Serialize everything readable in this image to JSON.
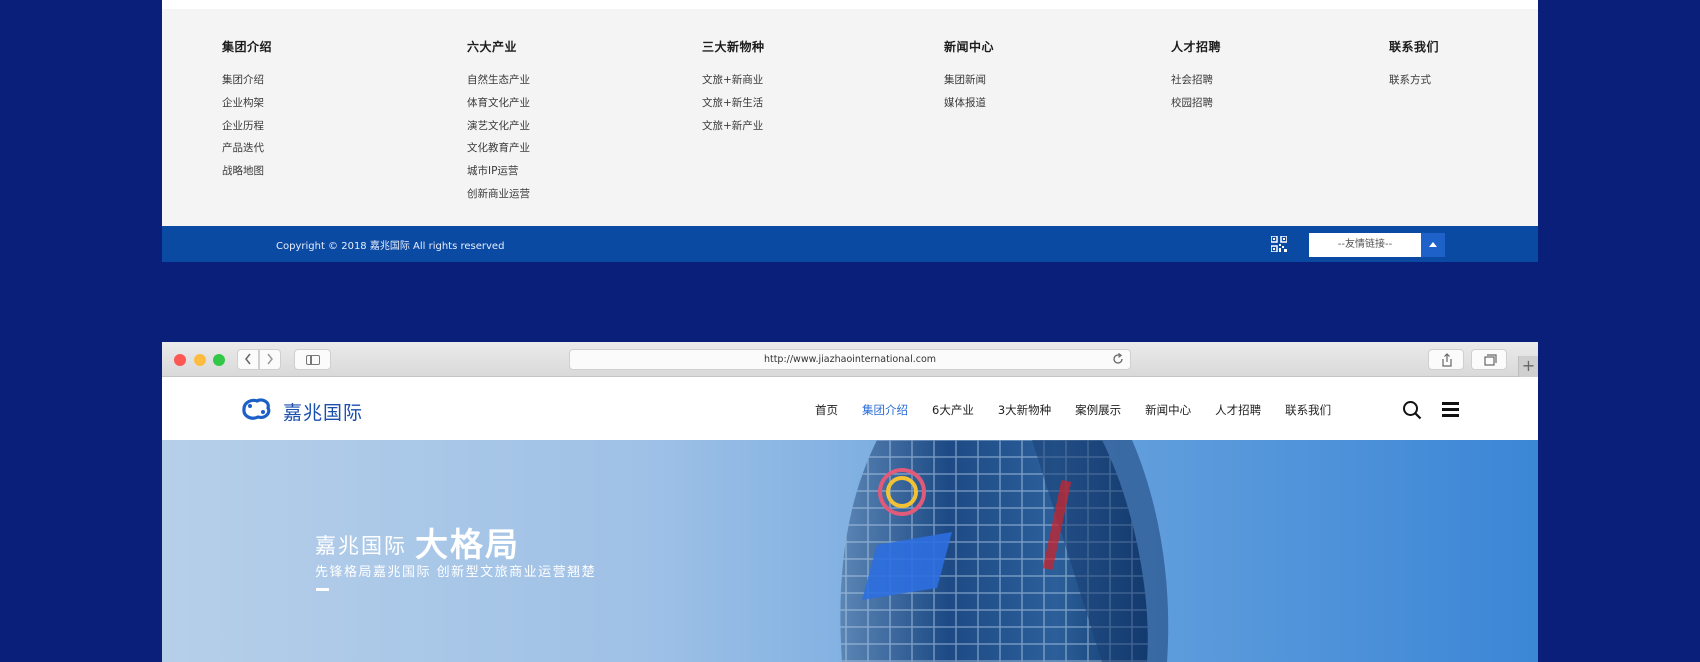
{
  "footer": {
    "columns": [
      {
        "title": "集团介绍",
        "items": [
          "集团介绍",
          "企业构架",
          "企业历程",
          "产品迭代",
          "战略地图"
        ]
      },
      {
        "title": "六大产业",
        "items": [
          "自然生态产业",
          "体育文化产业",
          "演艺文化产业",
          "文化教育产业",
          "城市IP运营",
          "创新商业运营"
        ]
      },
      {
        "title": "三大新物种",
        "items": [
          "文旅+新商业",
          "文旅+新生活",
          "文旅+新产业"
        ]
      },
      {
        "title": "新闻中心",
        "items": [
          "集团新闻",
          "媒体报道"
        ]
      },
      {
        "title": "人才招聘",
        "items": [
          "社会招聘",
          "校园招聘"
        ]
      },
      {
        "title": "联系我们",
        "items": [
          "联系方式"
        ]
      }
    ],
    "copyright": "Copyright © 2018  嘉兆国际  All rights reserved",
    "friend_links_placeholder": "--友情链接--",
    "qr_icon": "qr-code-icon"
  },
  "browser": {
    "url": "http://www.jiazhaointernational.com",
    "traffic_lights": [
      "#fc5753",
      "#fdbc40",
      "#33c748"
    ]
  },
  "site": {
    "logo_text": "嘉兆国际",
    "menu": [
      {
        "label": "首页",
        "active": false
      },
      {
        "label": "集团介绍",
        "active": true
      },
      {
        "label": "6大产业",
        "active": false
      },
      {
        "label": "3大新物种",
        "active": false
      },
      {
        "label": "案例展示",
        "active": false
      },
      {
        "label": "新闻中心",
        "active": false
      },
      {
        "label": "人才招聘",
        "active": false
      },
      {
        "label": "联系我们",
        "active": false
      }
    ],
    "hero": {
      "title_small": "嘉兆国际",
      "title_large": "大格局",
      "subtitle": "先锋格局嘉兆国际  创新型文旅商业运营翘楚"
    }
  },
  "colors": {
    "page_background": "#0a1f7a",
    "footer_bar": "#0a4aa3",
    "brand_blue": "#1b4fae",
    "menu_active": "#2a6bd8"
  }
}
